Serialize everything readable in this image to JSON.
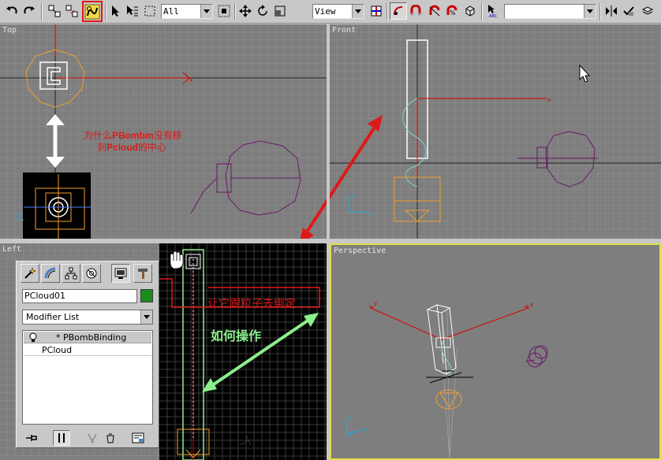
{
  "toolbar": {
    "selection_filter": "All",
    "reference_coord": "View",
    "named_selection": ""
  },
  "viewports": {
    "top": "Top",
    "front": "Front",
    "left": "Left",
    "perspective": "Perspective"
  },
  "panel": {
    "object_name": "PCloud01",
    "object_color": "#1a8c1a",
    "modifier_list": "Modifier List",
    "stack": [
      "* PBombBinding",
      "PCloud"
    ]
  },
  "annotations": {
    "question": "为什么PBombm没有移\n到Pcloud的中心",
    "howto": "如何操作",
    "boxed": "让它跟粒子去绑定"
  },
  "colors": {
    "viewport_bg": "#7e7e7e",
    "active_viewport_border": "#e6df48",
    "annotation_red": "#e01818",
    "annotation_green": "#8cf08c"
  }
}
